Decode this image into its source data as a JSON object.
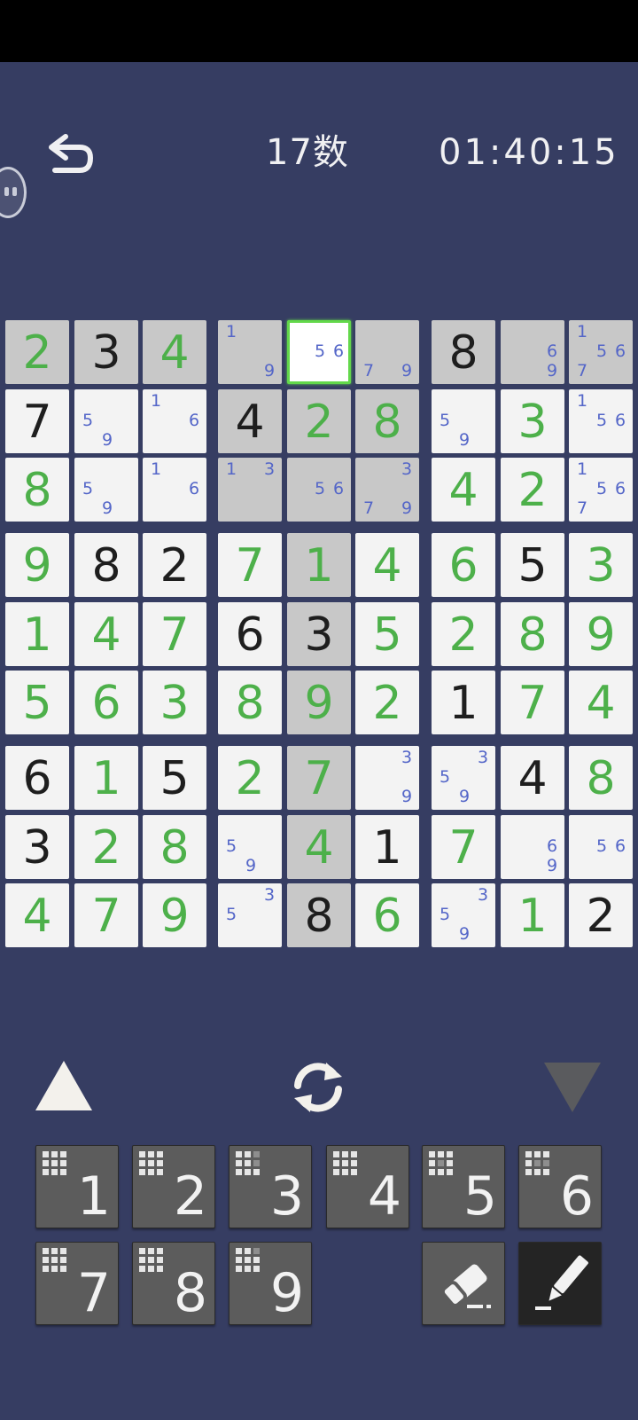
{
  "header": {
    "title": "17数",
    "timer": "01:40:15"
  },
  "board": {
    "rows": [
      [
        {
          "v": "2",
          "t": "entered",
          "s": 1
        },
        {
          "v": "3",
          "t": "given",
          "s": 1
        },
        {
          "v": "4",
          "t": "entered",
          "s": 1
        },
        {
          "c": [
            "1",
            "",
            "",
            "",
            "",
            "",
            "",
            "",
            "9"
          ],
          "s": 1
        },
        {
          "c": [
            "",
            "",
            "",
            "",
            "5",
            "6",
            "",
            "",
            ""
          ],
          "sel": 1
        },
        {
          "c": [
            "",
            "",
            "",
            "",
            "",
            "",
            "7",
            "",
            "9"
          ],
          "s": 1
        },
        {
          "v": "8",
          "t": "given",
          "s": 1
        },
        {
          "c": [
            "",
            "",
            "",
            "",
            "",
            "6",
            "",
            "",
            "9"
          ],
          "s": 1
        },
        {
          "c": [
            "1",
            "",
            "",
            "",
            "5",
            "6",
            "7",
            "",
            ""
          ],
          "s": 1
        }
      ],
      [
        {
          "v": "7",
          "t": "given"
        },
        {
          "c": [
            "",
            "",
            "",
            "5",
            "",
            "",
            "",
            "9",
            ""
          ]
        },
        {
          "c": [
            "1",
            "",
            "",
            "",
            "",
            "6",
            "",
            "",
            ""
          ]
        },
        {
          "v": "4",
          "t": "given",
          "s": 1
        },
        {
          "v": "2",
          "t": "entered",
          "s": 1
        },
        {
          "v": "8",
          "t": "entered",
          "s": 1
        },
        {
          "c": [
            "",
            "",
            "",
            "5",
            "",
            "",
            "",
            "9",
            ""
          ]
        },
        {
          "v": "3",
          "t": "entered"
        },
        {
          "c": [
            "1",
            "",
            "",
            "",
            "5",
            "6",
            "",
            "",
            ""
          ]
        }
      ],
      [
        {
          "v": "8",
          "t": "entered"
        },
        {
          "c": [
            "",
            "",
            "",
            "5",
            "",
            "",
            "",
            "9",
            ""
          ]
        },
        {
          "c": [
            "1",
            "",
            "",
            "",
            "",
            "6",
            "",
            "",
            ""
          ]
        },
        {
          "c": [
            "1",
            "",
            "3",
            "",
            "",
            "",
            "",
            "",
            ""
          ],
          "s": 1
        },
        {
          "c": [
            "",
            "",
            "",
            "",
            "5",
            "6",
            "",
            "",
            ""
          ],
          "s": 1
        },
        {
          "c": [
            "",
            "",
            "3",
            "",
            "",
            "",
            "7",
            "",
            "9"
          ],
          "s": 1
        },
        {
          "v": "4",
          "t": "entered"
        },
        {
          "v": "2",
          "t": "entered"
        },
        {
          "c": [
            "1",
            "",
            "",
            "",
            "5",
            "6",
            "7",
            "",
            ""
          ]
        }
      ],
      [
        {
          "v": "9",
          "t": "entered"
        },
        {
          "v": "8",
          "t": "given"
        },
        {
          "v": "2",
          "t": "given"
        },
        {
          "v": "7",
          "t": "entered"
        },
        {
          "v": "1",
          "t": "entered",
          "s": 1
        },
        {
          "v": "4",
          "t": "entered"
        },
        {
          "v": "6",
          "t": "entered"
        },
        {
          "v": "5",
          "t": "given"
        },
        {
          "v": "3",
          "t": "entered"
        }
      ],
      [
        {
          "v": "1",
          "t": "entered"
        },
        {
          "v": "4",
          "t": "entered"
        },
        {
          "v": "7",
          "t": "entered"
        },
        {
          "v": "6",
          "t": "given"
        },
        {
          "v": "3",
          "t": "given",
          "s": 1
        },
        {
          "v": "5",
          "t": "entered"
        },
        {
          "v": "2",
          "t": "entered"
        },
        {
          "v": "8",
          "t": "entered"
        },
        {
          "v": "9",
          "t": "entered"
        }
      ],
      [
        {
          "v": "5",
          "t": "entered"
        },
        {
          "v": "6",
          "t": "entered"
        },
        {
          "v": "3",
          "t": "entered"
        },
        {
          "v": "8",
          "t": "entered"
        },
        {
          "v": "9",
          "t": "entered",
          "s": 1
        },
        {
          "v": "2",
          "t": "entered"
        },
        {
          "v": "1",
          "t": "given"
        },
        {
          "v": "7",
          "t": "entered"
        },
        {
          "v": "4",
          "t": "entered"
        }
      ],
      [
        {
          "v": "6",
          "t": "given"
        },
        {
          "v": "1",
          "t": "entered"
        },
        {
          "v": "5",
          "t": "given"
        },
        {
          "v": "2",
          "t": "entered"
        },
        {
          "v": "7",
          "t": "entered",
          "s": 1
        },
        {
          "c": [
            "",
            "",
            "3",
            "",
            "",
            "",
            "",
            "",
            "9"
          ]
        },
        {
          "c": [
            "",
            "",
            "3",
            "5",
            "",
            "",
            "",
            "9",
            ""
          ]
        },
        {
          "v": "4",
          "t": "given"
        },
        {
          "v": "8",
          "t": "entered"
        }
      ],
      [
        {
          "v": "3",
          "t": "given"
        },
        {
          "v": "2",
          "t": "entered"
        },
        {
          "v": "8",
          "t": "entered"
        },
        {
          "c": [
            "",
            "",
            "",
            "5",
            "",
            "",
            "",
            "9",
            ""
          ]
        },
        {
          "v": "4",
          "t": "entered",
          "s": 1
        },
        {
          "v": "1",
          "t": "given"
        },
        {
          "v": "7",
          "t": "entered"
        },
        {
          "c": [
            "",
            "",
            "",
            "",
            "",
            "6",
            "",
            "",
            "9"
          ]
        },
        {
          "c": [
            "",
            "",
            "",
            "",
            "5",
            "6",
            "",
            "",
            ""
          ]
        }
      ],
      [
        {
          "v": "4",
          "t": "entered"
        },
        {
          "v": "7",
          "t": "entered"
        },
        {
          "v": "9",
          "t": "entered"
        },
        {
          "c": [
            "",
            "",
            "3",
            "5",
            "",
            "",
            "",
            "",
            ""
          ]
        },
        {
          "v": "8",
          "t": "given",
          "s": 1
        },
        {
          "v": "6",
          "t": "entered"
        },
        {
          "c": [
            "",
            "",
            "3",
            "5",
            "",
            "",
            "",
            "9",
            ""
          ]
        },
        {
          "v": "1",
          "t": "entered"
        },
        {
          "v": "2",
          "t": "given"
        }
      ]
    ]
  },
  "controls": {
    "up_icon": "triangle-up-icon",
    "down_icon": "triangle-down-icon",
    "refresh_icon": "refresh-icon"
  },
  "keypad": {
    "keys": [
      {
        "label": "1",
        "grid": [
          1,
          1,
          1,
          1,
          1,
          1,
          1,
          1,
          1
        ]
      },
      {
        "label": "2",
        "grid": [
          1,
          1,
          1,
          1,
          1,
          1,
          1,
          1,
          1
        ]
      },
      {
        "label": "3",
        "grid": [
          1,
          1,
          0,
          1,
          1,
          0,
          1,
          1,
          1
        ]
      },
      {
        "label": "4",
        "grid": [
          1,
          1,
          1,
          1,
          1,
          1,
          1,
          1,
          1
        ]
      },
      {
        "label": "5",
        "grid": [
          1,
          1,
          1,
          1,
          0,
          1,
          1,
          1,
          1
        ]
      },
      {
        "label": "6",
        "grid": [
          1,
          1,
          1,
          1,
          0,
          0,
          1,
          1,
          1
        ]
      },
      {
        "label": "7",
        "grid": [
          1,
          1,
          1,
          1,
          1,
          1,
          1,
          1,
          1
        ]
      },
      {
        "label": "8",
        "grid": [
          1,
          1,
          1,
          1,
          1,
          1,
          1,
          1,
          1
        ]
      },
      {
        "label": "9",
        "grid": [
          1,
          1,
          0,
          1,
          1,
          1,
          1,
          1,
          1
        ]
      }
    ],
    "eraser_icon": "eraser-icon",
    "pencil_icon": "pencil-icon"
  },
  "colors": {
    "background": "#363d62",
    "given_digit": "#1e1e1e",
    "entered_digit": "#4db04a",
    "candidate": "#5466c8",
    "selection": "#62d84a"
  }
}
